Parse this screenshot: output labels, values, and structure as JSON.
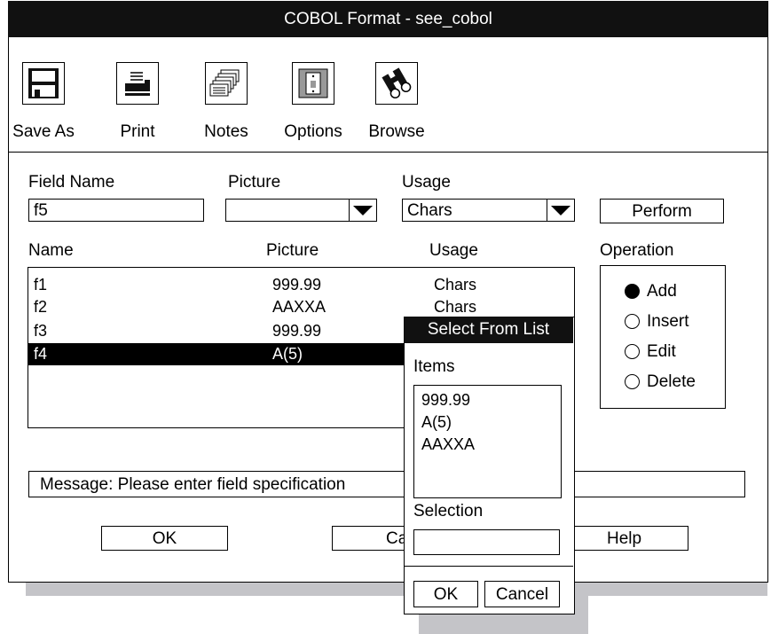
{
  "window": {
    "title": "COBOL Format - see_cobol"
  },
  "toolbar": {
    "items": [
      {
        "label": "Save As",
        "icon": "floppy-disk-icon"
      },
      {
        "label": "Print",
        "icon": "printer-icon"
      },
      {
        "label": "Notes",
        "icon": "notes-icon"
      },
      {
        "label": "Options",
        "icon": "switch-icon"
      },
      {
        "label": "Browse",
        "icon": "binoculars-icon"
      }
    ]
  },
  "form": {
    "field_name_label": "Field Name",
    "field_name_value": "f5",
    "picture_label": "Picture",
    "picture_value": "",
    "usage_label": "Usage",
    "usage_value": "Chars",
    "perform_label": "Perform"
  },
  "table": {
    "headers": [
      "Name",
      "Picture",
      "Usage"
    ],
    "rows": [
      {
        "name": "f1",
        "picture": "999.99",
        "usage": "Chars"
      },
      {
        "name": "f2",
        "picture": "AAXXA",
        "usage": "Chars"
      },
      {
        "name": "f3",
        "picture": "999.99",
        "usage": ""
      },
      {
        "name": "f4",
        "picture": "A(5)",
        "usage": ""
      }
    ],
    "selected_row": 3
  },
  "operation": {
    "label": "Operation",
    "options": [
      "Add",
      "Insert",
      "Edit",
      "Delete"
    ],
    "selected": "Add"
  },
  "message": {
    "text": "Message: Please enter field specification"
  },
  "buttons": {
    "ok": "OK",
    "cancel_partial": "Can",
    "help": "Help"
  },
  "popup": {
    "title": "Select From List",
    "items_label": "Items",
    "items": [
      "999.99",
      "A(5)",
      "AAXXA"
    ],
    "selection_label": "Selection",
    "selection_value": "",
    "ok": "OK",
    "cancel": "Cancel"
  }
}
